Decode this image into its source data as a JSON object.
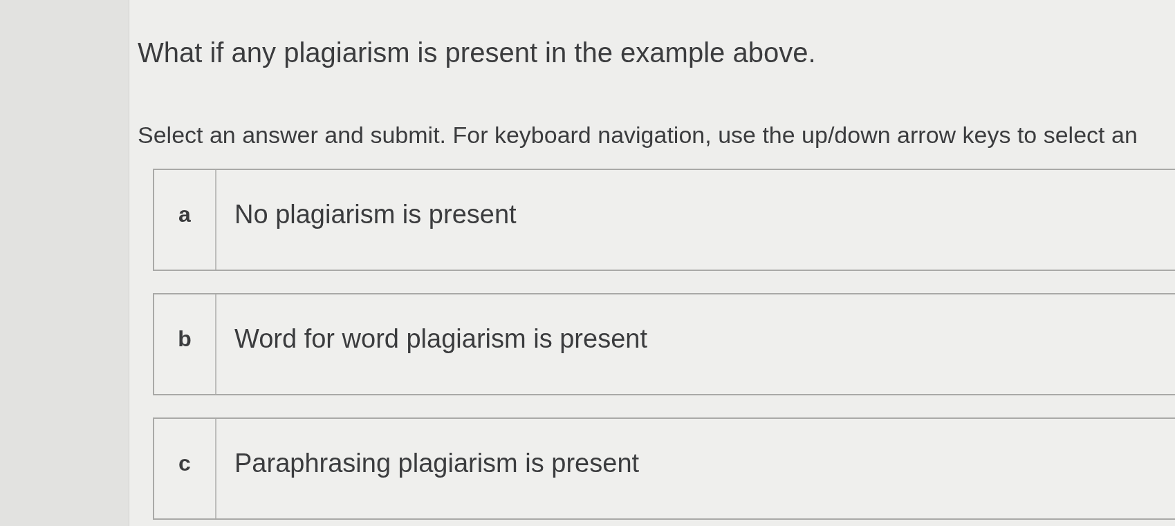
{
  "question": {
    "title": "What if any plagiarism is present in the example above.",
    "instructions": "Select an answer and submit. For keyboard navigation, use the up/down arrow keys to select an"
  },
  "options": [
    {
      "letter": "a",
      "text": "No plagiarism is present",
      "selected": false
    },
    {
      "letter": "b",
      "text": "Word for word plagiarism is present",
      "selected": false
    },
    {
      "letter": "c",
      "text": "Paraphrasing plagiarism is present",
      "selected": false
    }
  ]
}
